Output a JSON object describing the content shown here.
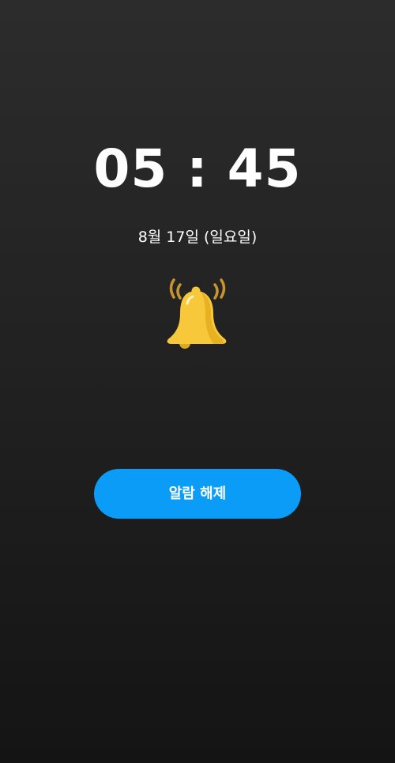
{
  "alarm": {
    "hour": "05",
    "separator": ":",
    "minute": "45",
    "time_display": "05 : 45",
    "date": "8월 17일 (일요일)",
    "icon": "bell-ringing-icon",
    "dismiss_label": "알람 해제"
  },
  "colors": {
    "background_top": "#2c2c2c",
    "background_bottom": "#141414",
    "accent": "#0a9cf7",
    "bell": "#f7c83a",
    "text": "#ffffff"
  }
}
